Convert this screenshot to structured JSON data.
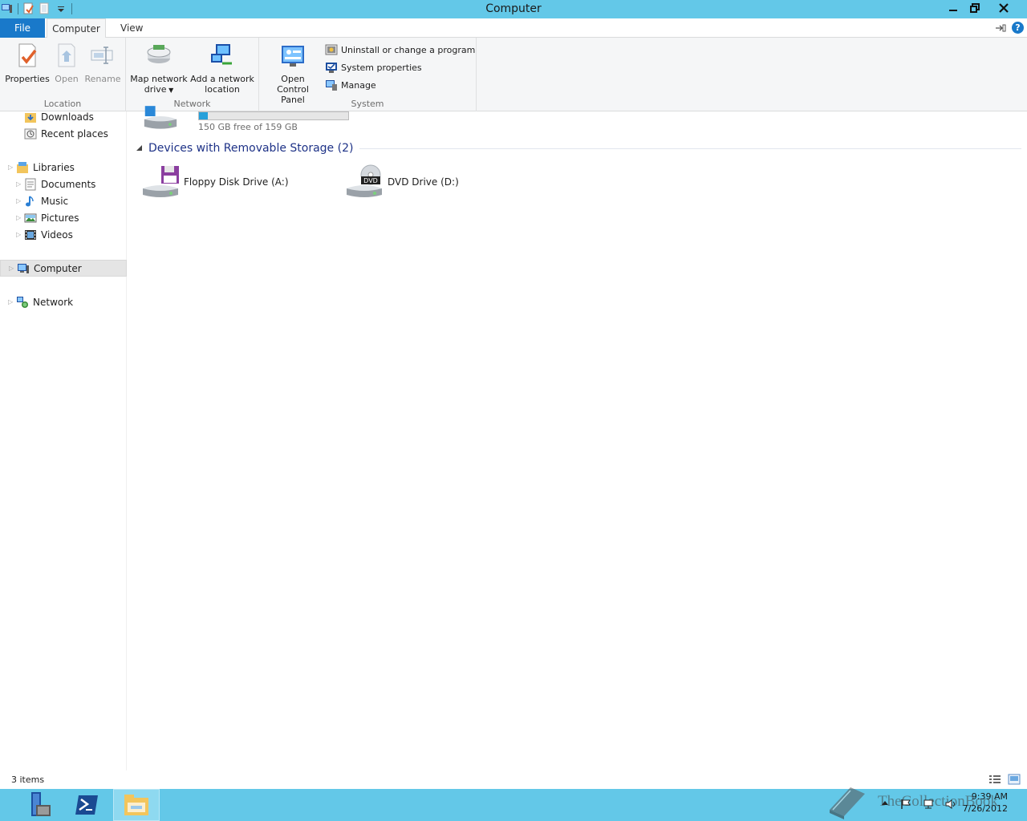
{
  "window": {
    "title": "Computer"
  },
  "tabs": [
    {
      "label": "File"
    },
    {
      "label": "Computer"
    },
    {
      "label": "View"
    }
  ],
  "ribbon": {
    "location": {
      "label": "Location",
      "properties": "Properties",
      "open": "Open",
      "rename": "Rename"
    },
    "network": {
      "label": "Network",
      "map_line1": "Map network",
      "map_line2": "drive",
      "add_line1": "Add a network",
      "add_line2": "location"
    },
    "system": {
      "label": "System",
      "cp_line1": "Open Control",
      "cp_line2": "Panel",
      "uninstall": "Uninstall or change a program",
      "sysprops": "System properties",
      "manage": "Manage"
    }
  },
  "nav": {
    "downloads": "Downloads",
    "recent": "Recent places",
    "libraries": "Libraries",
    "documents": "Documents",
    "music": "Music",
    "pictures": "Pictures",
    "videos": "Videos",
    "computer": "Computer",
    "network": "Network"
  },
  "content": {
    "drive_c": {
      "capacity_text": "150 GB free of 159 GB",
      "used_fraction": 0.057
    },
    "removable_header": "Devices with Removable Storage (2)",
    "floppy": "Floppy Disk Drive (A:)",
    "dvd": "DVD Drive (D:)",
    "dvd_badge": "DVD"
  },
  "status": {
    "count": "3 items"
  },
  "taskbar": {
    "time": "9:39 AM",
    "date": "7/26/2012",
    "watermark": "TheCollectionBook"
  },
  "colors": {
    "accent": "#1979ca",
    "titlebar": "#63c8e8",
    "group_header": "#1e3287",
    "capacity_fill": "#26a0da"
  }
}
